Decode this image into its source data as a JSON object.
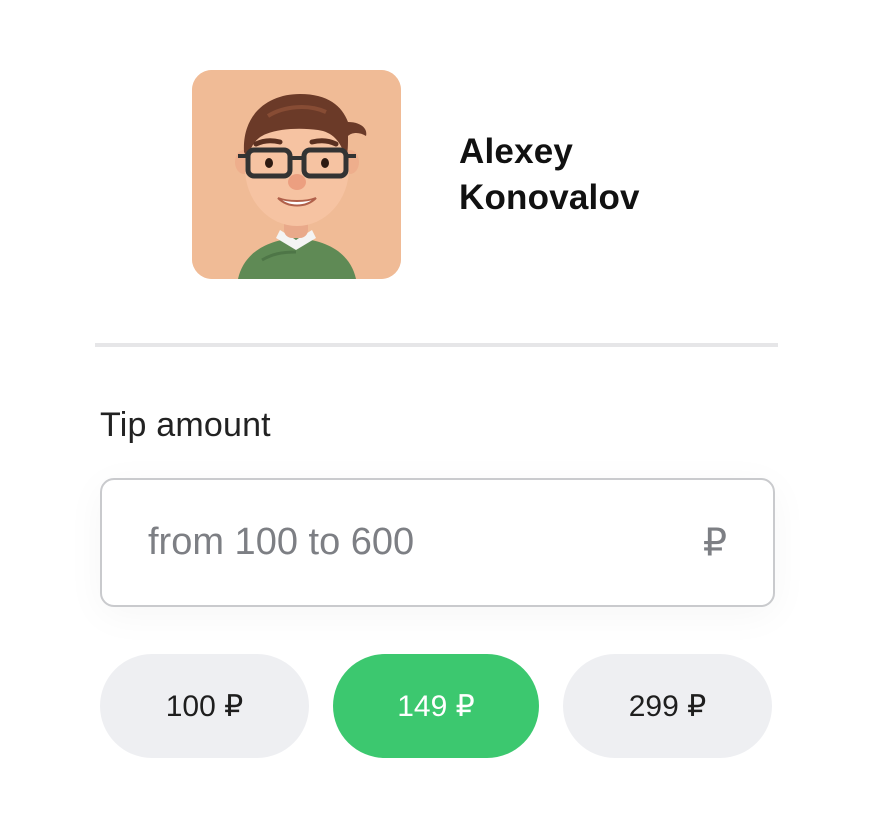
{
  "profile": {
    "first_name": "Alexey",
    "last_name": "Konovalov",
    "avatar_icon": "person-3d-avatar-icon",
    "avatar_bg": "#f0bb96"
  },
  "tip": {
    "label": "Tip amount",
    "input_value": "",
    "placeholder": "from 100 to 600",
    "currency_symbol": "₽"
  },
  "presets": [
    {
      "label": "100 ₽",
      "selected": false
    },
    {
      "label": "149 ₽",
      "selected": true
    },
    {
      "label": "299 ₽",
      "selected": false
    }
  ],
  "colors": {
    "accent": "#3cc86f",
    "chip_bg": "#eeeff2",
    "divider": "#e6e6e8",
    "placeholder": "#7d7f84"
  }
}
